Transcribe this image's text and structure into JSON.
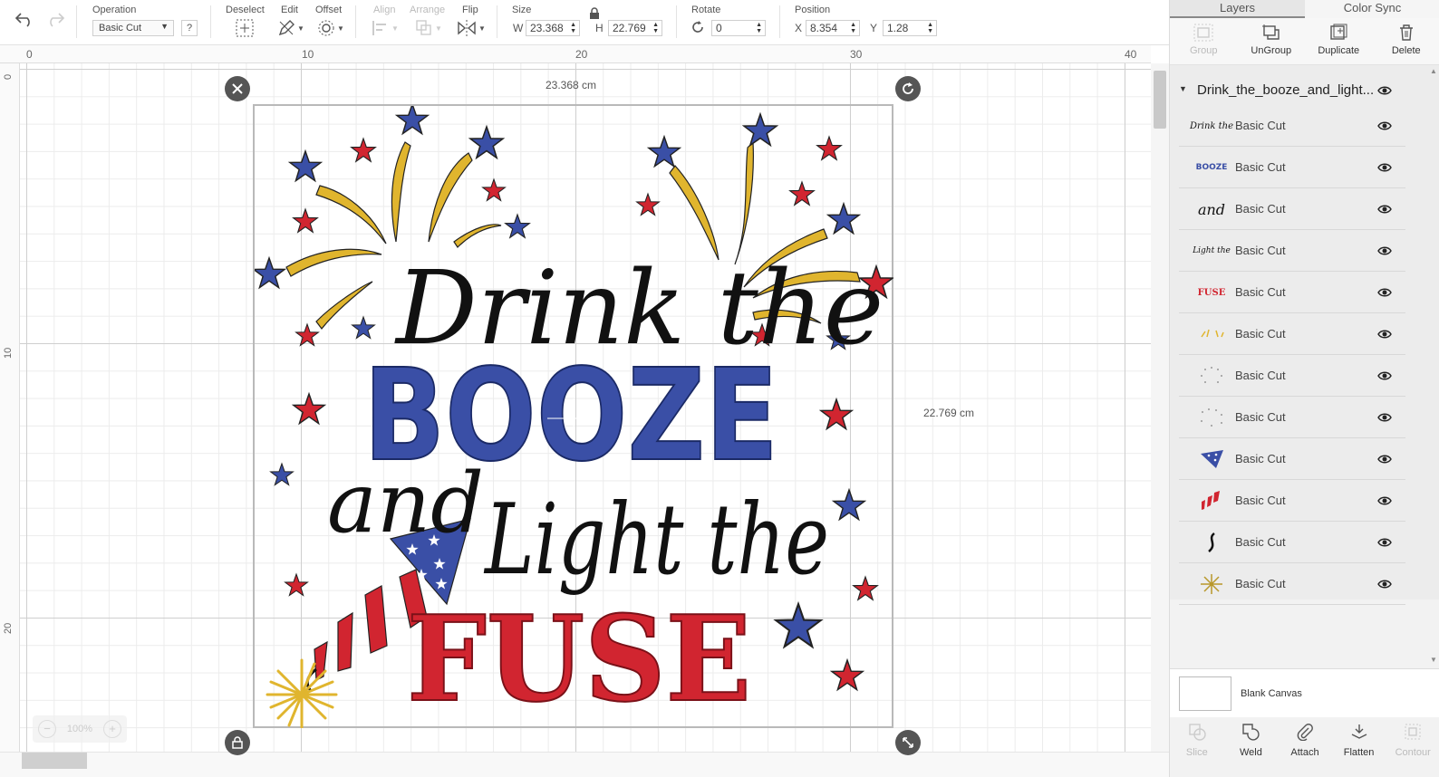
{
  "toolbar": {
    "operation_label": "Operation",
    "operation_value": "Basic Cut",
    "help_label": "?",
    "deselect_label": "Deselect",
    "edit_label": "Edit",
    "offset_label": "Offset",
    "align_label": "Align",
    "arrange_label": "Arrange",
    "flip_label": "Flip",
    "size_label": "Size",
    "w_prefix": "W",
    "w_value": "23.368",
    "h_prefix": "H",
    "h_value": "22.769",
    "rotate_label": "Rotate",
    "rotate_value": "0",
    "position_label": "Position",
    "x_prefix": "X",
    "x_value": "8.354",
    "y_prefix": "Y",
    "y_value": "1.28"
  },
  "ruler": {
    "top": [
      "0",
      "10",
      "20",
      "30",
      "40"
    ],
    "left": [
      "0",
      "10",
      "20"
    ]
  },
  "canvas": {
    "width_label": "23.368 cm",
    "height_label": "22.769 cm",
    "zoom_value": "100%",
    "zoom_minus": "−",
    "zoom_plus": "+"
  },
  "design": {
    "line1": "Drink the",
    "line2": "BOOZE",
    "line3a": "and",
    "line3b": "Light the",
    "line4": "FUSE"
  },
  "colors": {
    "blue": "#3a4fa6",
    "red": "#d12530",
    "gold": "#e0b52e",
    "black": "#111111"
  },
  "panel": {
    "tabs": [
      "Layers",
      "Color Sync"
    ],
    "actions": [
      "Group",
      "UnGroup",
      "Duplicate",
      "Delete"
    ],
    "group_name": "Drink_the_booze_and_light...",
    "layers": [
      {
        "thumb": "Drink the",
        "label": "Basic Cut"
      },
      {
        "thumb": "BOOZE",
        "label": "Basic Cut"
      },
      {
        "thumb": "and",
        "label": "Basic Cut"
      },
      {
        "thumb": "Light the",
        "label": "Basic Cut"
      },
      {
        "thumb": "FUSE",
        "label": "Basic Cut"
      },
      {
        "thumb": "",
        "label": "Basic Cut"
      },
      {
        "thumb": "",
        "label": "Basic Cut"
      },
      {
        "thumb": "",
        "label": "Basic Cut"
      },
      {
        "thumb": "",
        "label": "Basic Cut"
      },
      {
        "thumb": "",
        "label": "Basic Cut"
      },
      {
        "thumb": "",
        "label": "Basic Cut"
      },
      {
        "thumb": "",
        "label": "Basic Cut"
      }
    ],
    "blank_canvas_label": "Blank Canvas",
    "bottom_actions": [
      "Slice",
      "Weld",
      "Attach",
      "Flatten",
      "Contour"
    ]
  }
}
